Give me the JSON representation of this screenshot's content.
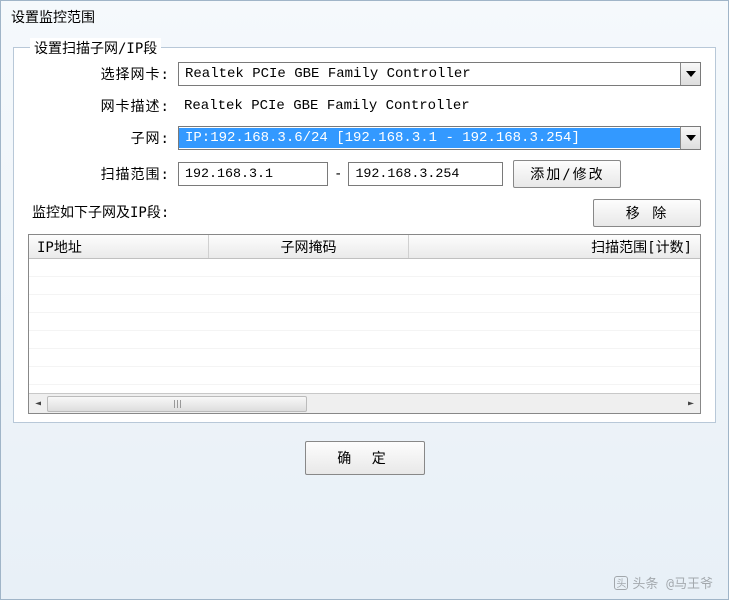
{
  "window": {
    "title": "设置监控范围"
  },
  "group": {
    "legend": "设置扫描子网/IP段",
    "nic_label": "选择网卡:",
    "nic_value": "Realtek PCIe GBE Family Controller",
    "desc_label": "网卡描述:",
    "desc_value": "Realtek PCIe GBE Family Controller",
    "subnet_label": "子网:",
    "subnet_value": "IP:192.168.3.6/24 [192.168.3.1 - 192.168.3.254]",
    "range_label": "扫描范围:",
    "range_from": "192.168.3.1",
    "range_to": "192.168.3.254",
    "add_button": "添加/修改"
  },
  "monitor": {
    "label": "监控如下子网及IP段:",
    "remove_button": "移 除",
    "columns": {
      "c1": "IP地址",
      "c2": "子网掩码",
      "c3": "扫描范围[计数]"
    }
  },
  "ok_button": "确 定",
  "watermark": "头条 @马王爷"
}
